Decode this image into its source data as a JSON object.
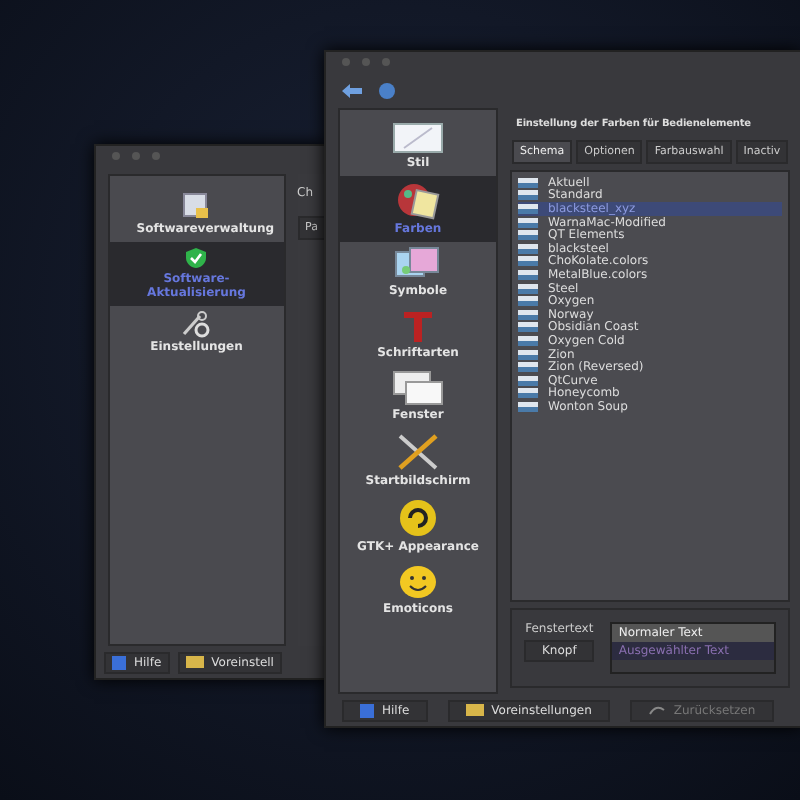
{
  "back_window": {
    "sidebar": {
      "items": [
        {
          "label": "Softwareverwaltung",
          "selected": false
        },
        {
          "label": "Software-Aktualisierung",
          "selected": true
        },
        {
          "label": "Einstellungen",
          "selected": false
        }
      ]
    },
    "heading": "Ch",
    "tab": "Pa",
    "buttons": [
      {
        "label": "Hilfe"
      },
      {
        "label": "Voreinstell"
      }
    ]
  },
  "front_window": {
    "sidebar": {
      "items": [
        {
          "label": "Stil",
          "selected": false
        },
        {
          "label": "Farben",
          "selected": true
        },
        {
          "label": "Symbole",
          "selected": false
        },
        {
          "label": "Schriftarten",
          "selected": false
        },
        {
          "label": "Fenster",
          "selected": false
        },
        {
          "label": "Startbildschirm",
          "selected": false
        },
        {
          "label": "GTK+ Appearance",
          "selected": false
        },
        {
          "label": "Emoticons",
          "selected": false
        }
      ]
    },
    "heading": "Einstellung der Farben für Bedienelemente",
    "tabs": [
      {
        "label": "Schema",
        "selected": true
      },
      {
        "label": "Optionen",
        "selected": false
      },
      {
        "label": "Farbauswahl",
        "selected": false
      },
      {
        "label": "Inactiv",
        "selected": false
      }
    ],
    "schemes": [
      {
        "name": "Aktuell",
        "selected": false
      },
      {
        "name": "Standard",
        "selected": false
      },
      {
        "name": "blacksteel_xyz",
        "selected": true
      },
      {
        "name": "WarnaMac-Modified",
        "selected": false
      },
      {
        "name": "QT Elements",
        "selected": false
      },
      {
        "name": "blacksteel",
        "selected": false
      },
      {
        "name": "ChoKolate.colors",
        "selected": false
      },
      {
        "name": "MetalBlue.colors",
        "selected": false
      },
      {
        "name": "Steel",
        "selected": false
      },
      {
        "name": "Oxygen",
        "selected": false
      },
      {
        "name": "Norway",
        "selected": false
      },
      {
        "name": "Obsidian Coast",
        "selected": false
      },
      {
        "name": "Oxygen Cold",
        "selected": false
      },
      {
        "name": "Zion",
        "selected": false
      },
      {
        "name": "Zion (Reversed)",
        "selected": false
      },
      {
        "name": "QtCurve",
        "selected": false
      },
      {
        "name": "Honeycomb",
        "selected": false
      },
      {
        "name": "Wonton Soup",
        "selected": false
      }
    ],
    "preview": {
      "label": "Fenstertext",
      "button": "Knopf",
      "normal_text": "Normaler Text",
      "selected_text": "Ausgewählter Text"
    },
    "buttons": [
      {
        "label": "Hilfe",
        "disabled": false
      },
      {
        "label": "Voreinstellungen",
        "disabled": false
      },
      {
        "label": "Zurücksetzen",
        "disabled": true
      }
    ]
  }
}
